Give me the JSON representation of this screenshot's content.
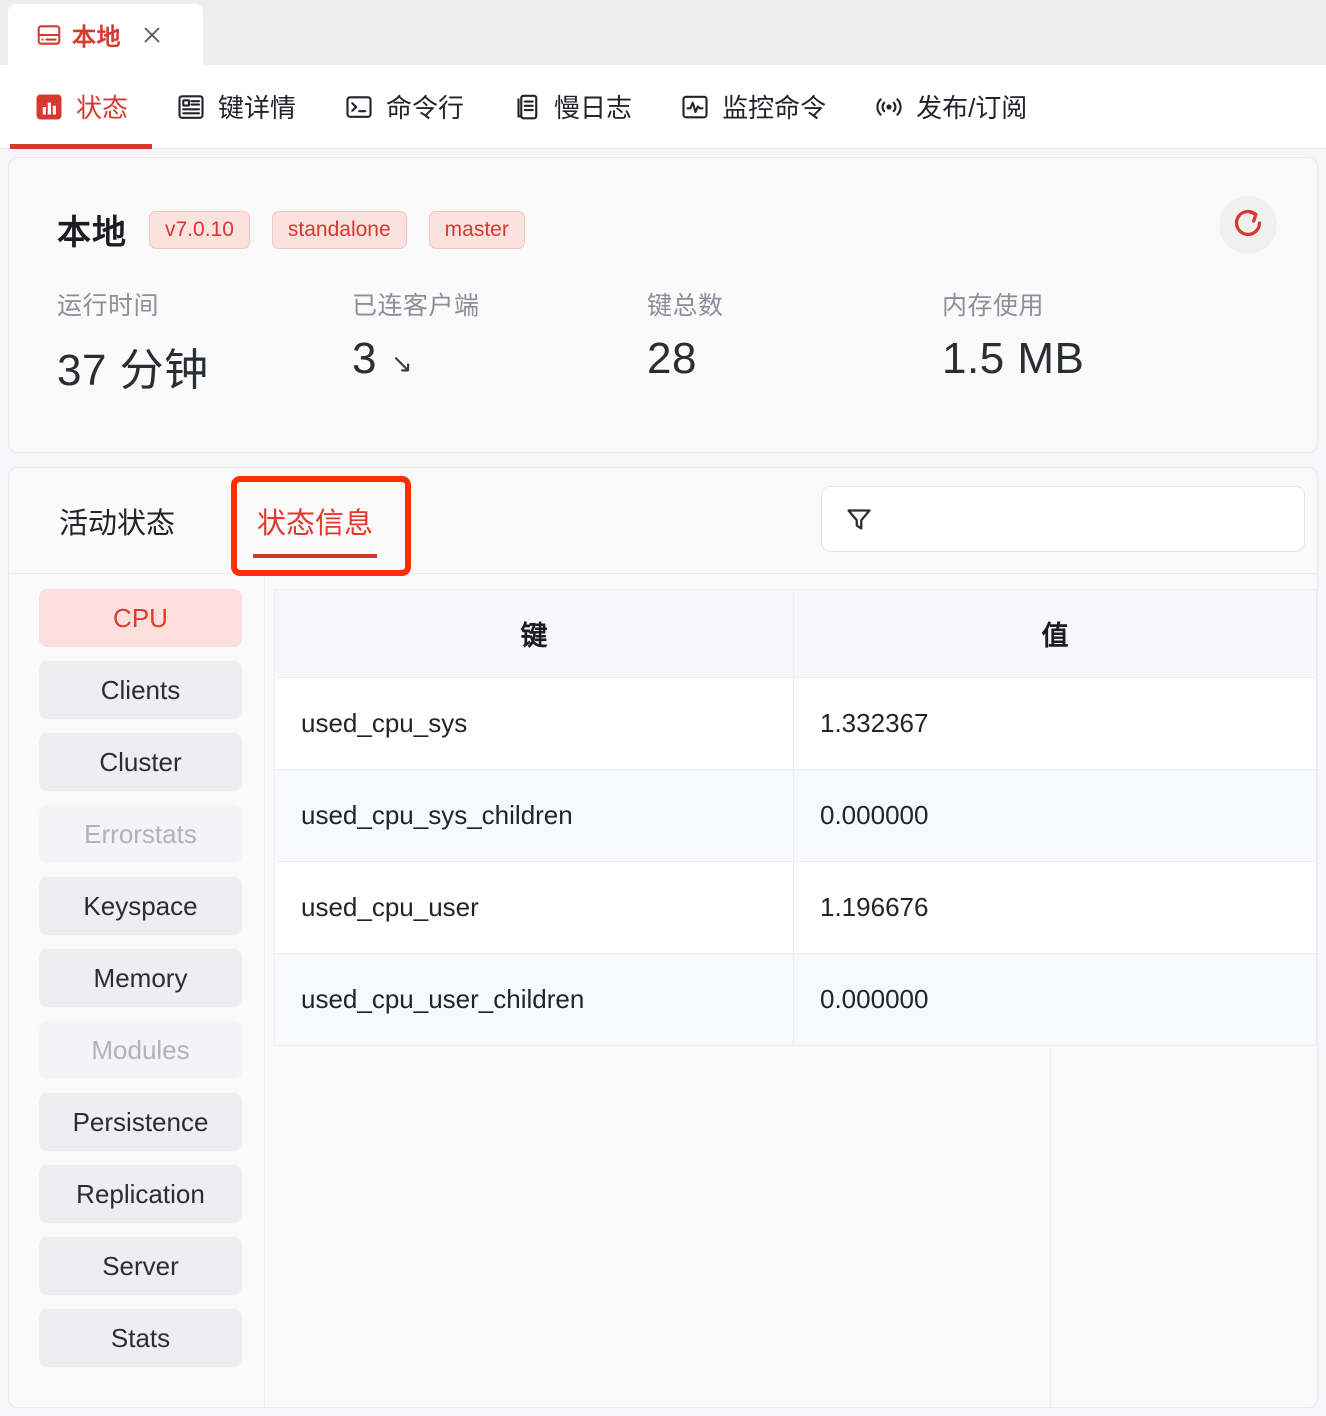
{
  "window": {
    "connection_tab": {
      "label": "本地",
      "icon": "database-icon",
      "close_icon": "close-icon"
    }
  },
  "nav": {
    "items": [
      {
        "label": "状态",
        "icon": "bar-chart-icon",
        "active": true
      },
      {
        "label": "键详情",
        "icon": "article-icon",
        "active": false
      },
      {
        "label": "命令行",
        "icon": "terminal-icon",
        "active": false
      },
      {
        "label": "慢日志",
        "icon": "documents-icon",
        "active": false
      },
      {
        "label": "监控命令",
        "icon": "pulse-icon",
        "active": false
      },
      {
        "label": "发布/订阅",
        "icon": "broadcast-icon",
        "active": false
      }
    ]
  },
  "overview": {
    "title": "本地",
    "badges": [
      "v7.0.10",
      "standalone",
      "master"
    ],
    "refresh_icon": "refresh-icon",
    "stats": [
      {
        "label": "运行时间",
        "value": "37 分钟",
        "trend": ""
      },
      {
        "label": "已连客户端",
        "value": "3",
        "trend": "↘"
      },
      {
        "label": "键总数",
        "value": "28",
        "trend": ""
      },
      {
        "label": "内存使用",
        "value": "1.5 MB",
        "trend": ""
      }
    ]
  },
  "panel": {
    "subtabs": [
      {
        "label": "活动状态",
        "active": false
      },
      {
        "label": "状态信息",
        "active": true
      }
    ],
    "filter": {
      "icon": "filter-icon",
      "value": "",
      "placeholder": ""
    },
    "sections": [
      {
        "label": "CPU",
        "state": "selected"
      },
      {
        "label": "Clients",
        "state": "normal"
      },
      {
        "label": "Cluster",
        "state": "normal"
      },
      {
        "label": "Errorstats",
        "state": "disabled"
      },
      {
        "label": "Keyspace",
        "state": "normal"
      },
      {
        "label": "Memory",
        "state": "normal"
      },
      {
        "label": "Modules",
        "state": "disabled"
      },
      {
        "label": "Persistence",
        "state": "normal"
      },
      {
        "label": "Replication",
        "state": "normal"
      },
      {
        "label": "Server",
        "state": "normal"
      },
      {
        "label": "Stats",
        "state": "normal"
      }
    ],
    "table": {
      "columns": [
        "键",
        "值"
      ],
      "rows": [
        {
          "key": "used_cpu_sys",
          "value": "1.332367"
        },
        {
          "key": "used_cpu_sys_children",
          "value": "0.000000"
        },
        {
          "key": "used_cpu_user",
          "value": "1.196676"
        },
        {
          "key": "used_cpu_user_children",
          "value": "0.000000"
        }
      ]
    }
  },
  "annotation": {
    "target": "状态信息",
    "color": "#ff2d00"
  },
  "colors": {
    "accent_red": "#d6392f",
    "annotation_red": "#ff2d00",
    "badge_bg": "#fbe2de",
    "selected_bg": "#fadfdc",
    "page_bg": "#f7f7f9"
  }
}
